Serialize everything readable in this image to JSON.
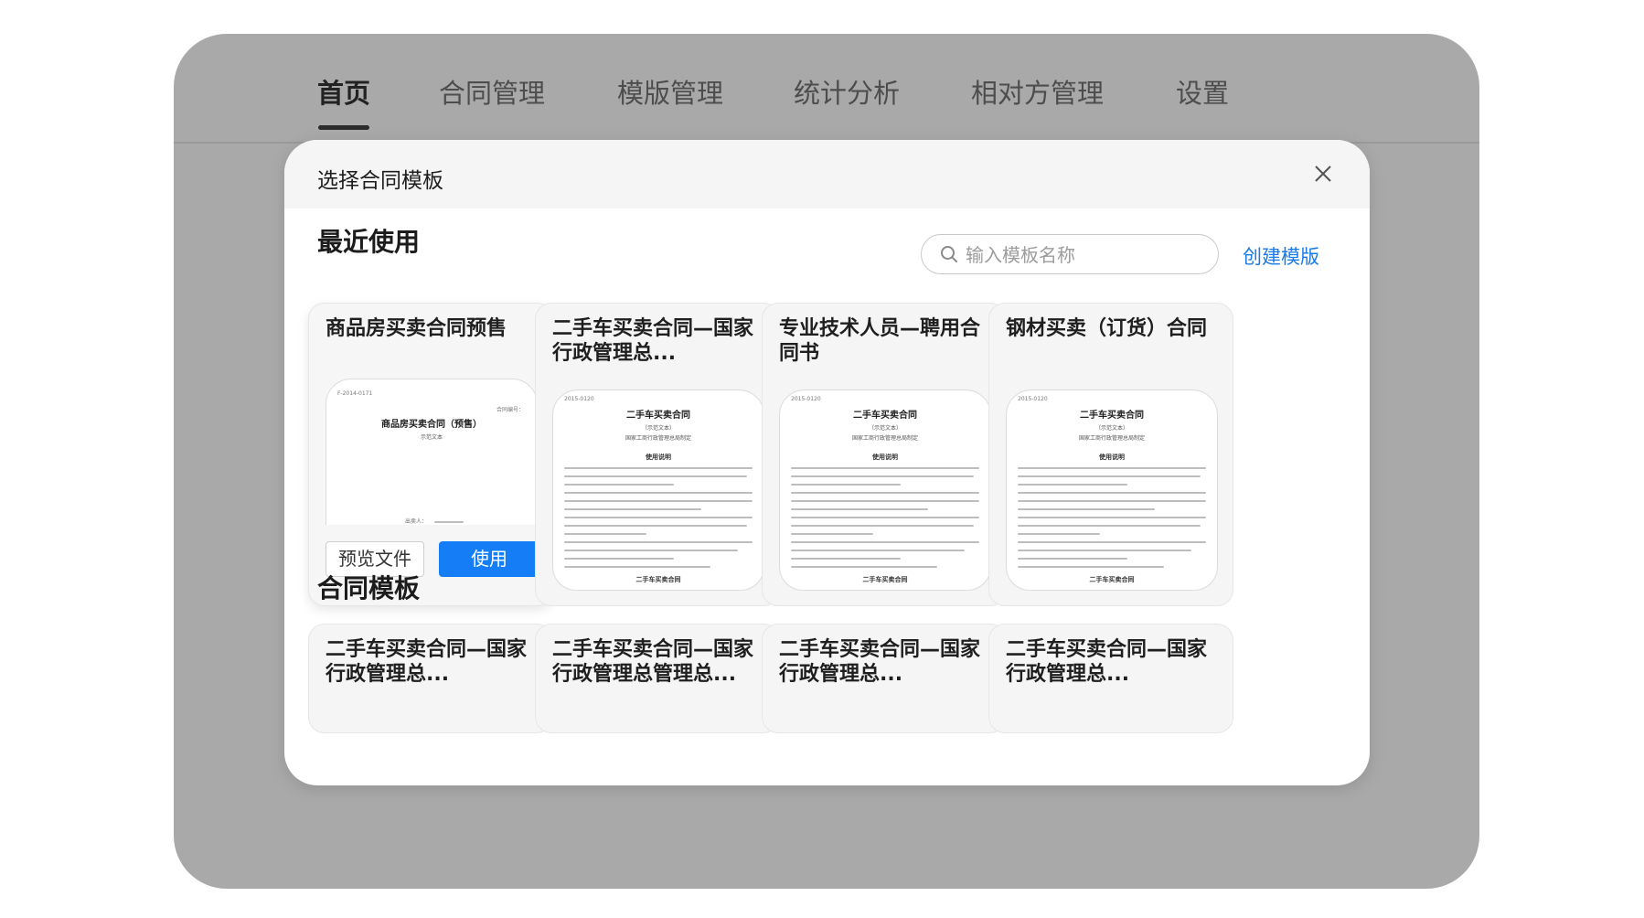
{
  "nav": {
    "tabs": [
      {
        "label": "首页",
        "active": true
      },
      {
        "label": "合同管理"
      },
      {
        "label": "模版管理"
      },
      {
        "label": "统计分析"
      },
      {
        "label": "相对方管理"
      },
      {
        "label": "设置"
      }
    ]
  },
  "modal": {
    "title": "选择合同模板",
    "close_icon": "close-icon",
    "recent_title": "最近使用",
    "search": {
      "placeholder": "输入模板名称",
      "value": "",
      "icon": "search-icon"
    },
    "create_label": "创建模版",
    "recent_cards": [
      {
        "title": "商品房买卖合同预售",
        "doc": {
          "code": "F-2014-0171",
          "number_label": "合同编号：",
          "title": "商品房买卖合同（预售）",
          "sub": "示范文本",
          "sign_label": "出卖人："
        },
        "preview_label": "预览文件",
        "use_label": "使用"
      },
      {
        "title": "二手车买卖合同—国家行政管理总...",
        "doc": {
          "code": "2015-0120",
          "title": "二手车买卖合同",
          "sub1": "（示范文本）",
          "sub2": "国家工商行政管理总局制定",
          "heading": "使用说明",
          "footer": "二手车买卖合同"
        }
      },
      {
        "title": "专业技术人员—聘用合同书",
        "doc": {
          "code": "2015-0120",
          "title": "二手车买卖合同",
          "sub1": "（示范文本）",
          "sub2": "国家工商行政管理总局制定",
          "heading": "使用说明",
          "footer": "二手车买卖合同"
        }
      },
      {
        "title": "钢材买卖（订货）合同",
        "doc": {
          "code": "2015-0120",
          "title": "二手车买卖合同",
          "sub1": "（示范文本）",
          "sub2": "国家工商行政管理总局制定",
          "heading": "使用说明",
          "footer": "二手车买卖合同"
        }
      }
    ],
    "templates_title": "合同模板",
    "template_cards": [
      {
        "title": "二手车买卖合同—国家行政管理总..."
      },
      {
        "title": "二手车买卖合同—国家行政管理总管理总..."
      },
      {
        "title": "二手车买卖合同—国家行政管理总..."
      },
      {
        "title": "二手车买卖合同—国家行政管理总..."
      }
    ]
  },
  "colors": {
    "accent": "#157ef6",
    "link": "#1a7ae8",
    "overlay": "#a9a9a9"
  }
}
